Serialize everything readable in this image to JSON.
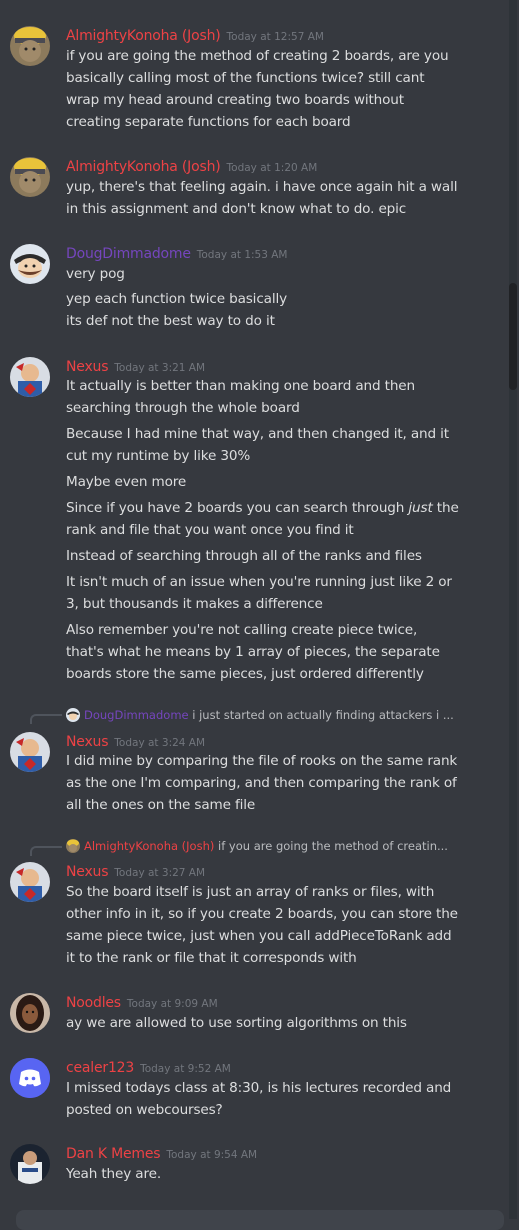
{
  "colors": {
    "red": "#ed4245",
    "purple": "#7546bd",
    "muted": "#72767d"
  },
  "messages": [
    {
      "author": "AlmightyKonoha (Josh)",
      "time": "Today at 12:57 AM",
      "lines": [
        "if you are going the method of creating 2 boards, are you",
        "basically calling most of the functions twice? still cant",
        "wrap my head around creating two boards without",
        "creating separate functions for each board"
      ]
    },
    {
      "author": "AlmightyKonoha (Josh)",
      "time": "Today at 1:20 AM",
      "lines": [
        "yup, there's that feeling again. i have once again hit a wall",
        "in this assignment and don't know what to do. epic"
      ]
    },
    {
      "author": "DougDimmadome",
      "time": "Today at 1:53 AM",
      "lines": [
        "very pog",
        "yep each function twice basically",
        "its def not the best way to do it"
      ]
    },
    {
      "author": "Nexus",
      "time": "Today at 3:21 AM",
      "lines": [
        "It actually is better than making one board and then",
        "searching through the whole board",
        "Because I had mine that way, and then changed it, and it",
        "cut my runtime by like 30%",
        "Maybe even more",
        "Since if you have 2 boards you can search through ",
        "just",
        " the",
        "rank and file that you want once you find it",
        "Instead of searching through all of the ranks and files",
        "It isn't much of an issue when you're running just like 2 or",
        "3, but thousands it makes a difference",
        "Also remember you're not calling create piece twice,",
        "that's what he means by 1 array of pieces, the separate",
        "boards store the same pieces, just ordered differently"
      ]
    },
    {
      "reply_author": "DougDimmadome",
      "reply_text": "i just started on actually finding attackers i ...",
      "author": "Nexus",
      "time": "Today at 3:24 AM",
      "lines": [
        "I did mine by comparing the file of rooks on the same rank",
        "as the one I'm comparing, and then comparing the rank of",
        "all the ones on the same file"
      ]
    },
    {
      "reply_author": "AlmightyKonoha (Josh)",
      "reply_text": "if you are going the method of creatin...",
      "author": "Nexus",
      "time": "Today at 3:27 AM",
      "lines": [
        "So the board itself is just an array of ranks or files, with",
        "other info in it, so if you create 2 boards, you can store the",
        "same piece twice, just when you call addPieceToRank add",
        "it to the rank or file that it corresponds with"
      ]
    },
    {
      "author": "Noodles",
      "time": "Today at 9:09 AM",
      "lines": [
        "ay we are allowed to use sorting algorithms on this"
      ]
    },
    {
      "author": "cealer123",
      "time": "Today at 9:52 AM",
      "lines": [
        "I missed todays class at 8:30, is his lectures recorded and",
        "posted on webcourses?"
      ]
    },
    {
      "author": "Dan K Memes",
      "time": "Today at 9:54 AM",
      "lines": [
        "Yeah they are."
      ]
    }
  ]
}
